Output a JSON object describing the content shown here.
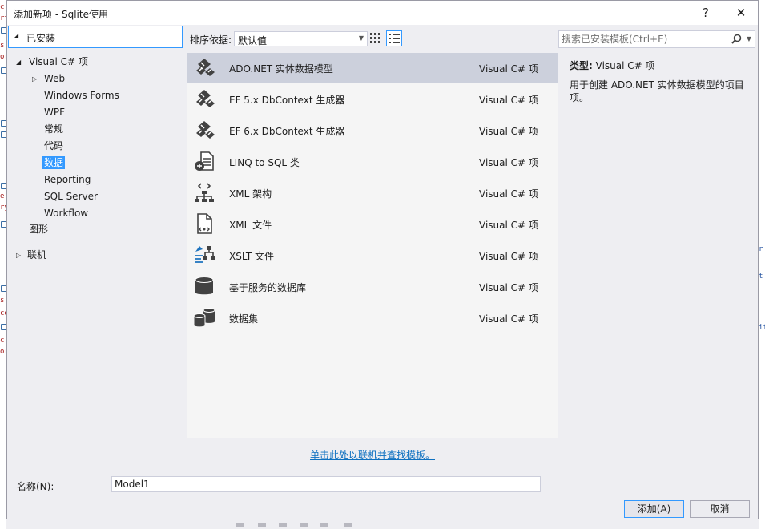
{
  "window": {
    "title": "添加新项 - Sqlite使用",
    "help_label": "?",
    "close_label": "✕"
  },
  "left": {
    "installed_label": "已安装",
    "tree": [
      {
        "label": "Visual C# 项"
      },
      {
        "label": "Web"
      },
      {
        "label": "Windows Forms"
      },
      {
        "label": "WPF"
      },
      {
        "label": "常规"
      },
      {
        "label": "代码"
      },
      {
        "label": "数据",
        "selected": true
      },
      {
        "label": "Reporting"
      },
      {
        "label": "SQL Server"
      },
      {
        "label": "Workflow"
      },
      {
        "label": "图形"
      },
      {
        "label": "联机"
      }
    ]
  },
  "toolbar": {
    "sort_label": "排序依据:",
    "sort_value": "默认值",
    "view_modes": [
      "small-icons-view-icon",
      "details-view-icon"
    ],
    "active_view": "details-view-icon"
  },
  "templates": [
    {
      "name": "ADO.NET 实体数据模型",
      "type": "Visual C# 项",
      "icon": "entity-model-icon",
      "selected": true
    },
    {
      "name": "EF 5.x DbContext 生成器",
      "type": "Visual C# 项",
      "icon": "dbcontext-generator-icon"
    },
    {
      "name": "EF 6.x DbContext 生成器",
      "type": "Visual C# 项",
      "icon": "dbcontext-generator-icon"
    },
    {
      "name": "LINQ to SQL 类",
      "type": "Visual C# 项",
      "icon": "linq-to-sql-icon"
    },
    {
      "name": "XML 架构",
      "type": "Visual C# 项",
      "icon": "xml-schema-icon"
    },
    {
      "name": "XML 文件",
      "type": "Visual C# 项",
      "icon": "xml-file-icon"
    },
    {
      "name": "XSLT 文件",
      "type": "Visual C# 项",
      "icon": "xslt-file-icon"
    },
    {
      "name": "基于服务的数据库",
      "type": "Visual C# 项",
      "icon": "database-icon"
    },
    {
      "name": "数据集",
      "type": "Visual C# 项",
      "icon": "dataset-icon"
    }
  ],
  "online_link": "单击此处以联机并查找模板。",
  "search": {
    "placeholder": "搜索已安装模板(Ctrl+E)"
  },
  "details": {
    "type_label": "类型:",
    "type_value": "Visual C# 项",
    "description": "用于创建 ADO.NET 实体数据模型的项目项。"
  },
  "bottom": {
    "name_label": "名称(N):",
    "name_value": "Model1",
    "add_label": "添加(A)",
    "cancel_label": "取消"
  },
  "colors": {
    "accent": "#3399ff",
    "selection_row": "#ccd0dc",
    "link": "#0e70c0",
    "dialog_bg": "#eeeef2"
  }
}
